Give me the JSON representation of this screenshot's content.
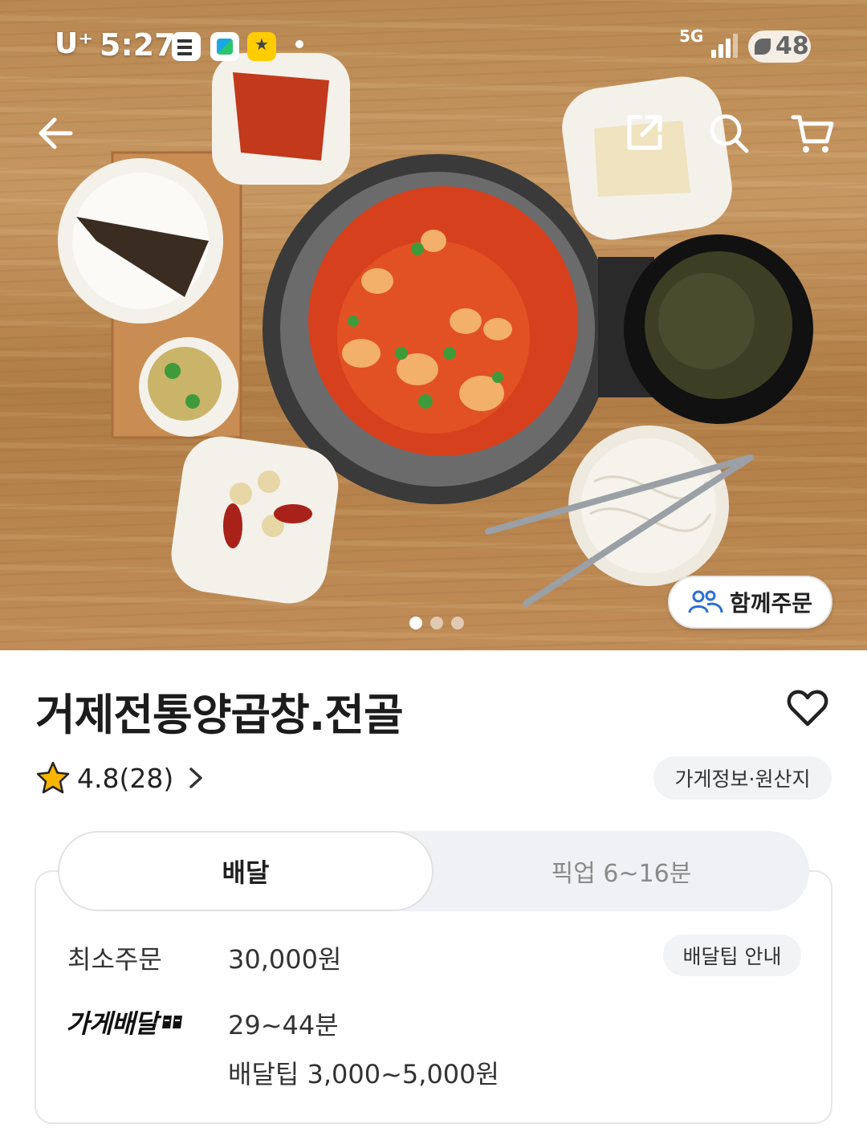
{
  "status_bar": {
    "carrier": "U⁺",
    "time": "5:27",
    "network": "5G",
    "battery": "48"
  },
  "hero": {
    "together_order_label": "함께주문",
    "pager_total": 3,
    "pager_active": 1
  },
  "store": {
    "name": "거제전통양곱창.전골",
    "rating": "4.8(28)",
    "info_button": "가게정보·원산지"
  },
  "order_tabs": {
    "delivery_label": "배달",
    "pickup_label": "픽업",
    "pickup_time": "6~16분"
  },
  "delivery_info": {
    "min_order_label": "최소주문",
    "min_order_value": "30,000원",
    "tip_info_button": "배달팁 안내",
    "store_delivery_label": "가게배달",
    "delivery_time": "29~44분",
    "delivery_tip": "배달팁 3,000~5,000원"
  },
  "colors": {
    "accent_icon": "#2b6fd6",
    "star": "#f7b500",
    "chip_bg": "#f1f3f5"
  }
}
